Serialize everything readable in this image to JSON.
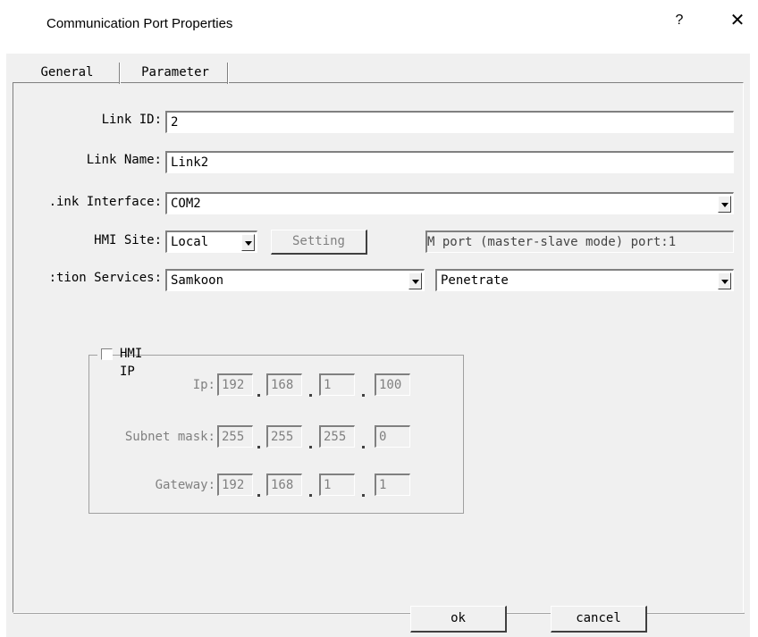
{
  "window": {
    "title": "Communication Port Properties",
    "help_label": "?",
    "close_label": "✕"
  },
  "tabs": [
    {
      "label": "General"
    },
    {
      "label": "Parameter"
    }
  ],
  "form": {
    "link_id_label": "Link ID:",
    "link_id_value": "2",
    "link_name_label": "Link Name:",
    "link_name_value": "Link2",
    "link_interface_label": ".ink Interface:",
    "link_interface_value": "COM2",
    "hmi_site_label": "HMI Site:",
    "hmi_site_value": "Local",
    "setting_label": "Setting",
    "port_info_value": "M port (master-slave mode) port:1",
    "services_label": ":tion Services:",
    "services_value": "Samkoon",
    "services_mode_value": "Penetrate"
  },
  "hmi_ip": {
    "title": "HMI IP",
    "checked": false,
    "ip_label": "Ip:",
    "ip": [
      "192",
      "168",
      "1",
      "100"
    ],
    "subnet_label": "Subnet mask:",
    "subnet": [
      "255",
      "255",
      "255",
      "0"
    ],
    "gateway_label": "Gateway:",
    "gateway": [
      "192",
      "168",
      "1",
      "1"
    ]
  },
  "footer": {
    "ok_label": "ok",
    "cancel_label": "cancel"
  }
}
